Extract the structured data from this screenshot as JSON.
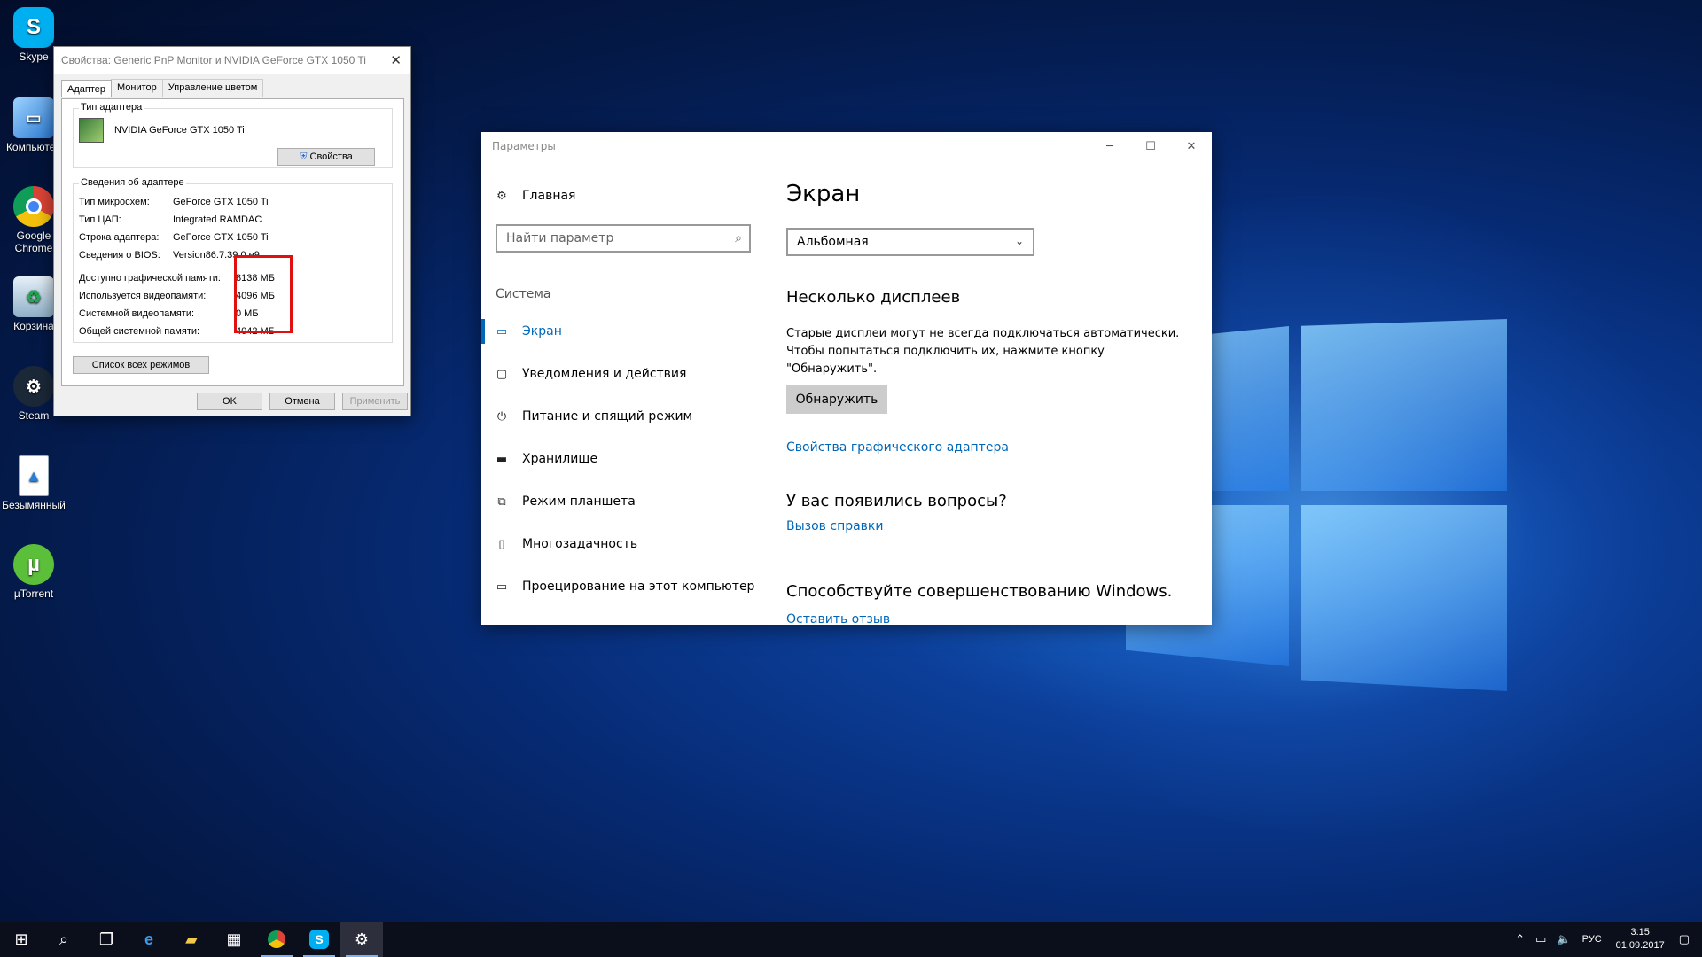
{
  "desktop": {
    "icons": [
      {
        "label": "Skype",
        "icon": "skype-icon",
        "color": "#00aff0"
      },
      {
        "label": "Компьютер",
        "icon": "computer-icon",
        "color": "#4a9be0"
      },
      {
        "label": "Google Chrome",
        "icon": "chrome-icon",
        "color": "#e0453a"
      },
      {
        "label": "Корзина",
        "icon": "recycle-bin-icon",
        "color": "#8fb0c8"
      },
      {
        "label": "Steam",
        "icon": "steam-icon",
        "color": "#1b2838"
      },
      {
        "label": "Безымянный",
        "icon": "image-file-icon",
        "color": "#e8f1fa"
      },
      {
        "label": "µTorrent",
        "icon": "utorrent-icon",
        "color": "#5bbf3a"
      }
    ]
  },
  "props": {
    "title": "Свойства: Generic PnP Monitor и NVIDIA GeForce GTX 1050 Ti",
    "tabs": [
      "Адаптер",
      "Монитор",
      "Управление цветом"
    ],
    "adapter_type_legend": "Тип адаптера",
    "adapter_name": "NVIDIA GeForce GTX 1050 Ti",
    "properties_button": "Свойства",
    "adapter_info_legend": "Сведения об адаптере",
    "info": [
      {
        "k": "Тип микросхем:",
        "v": "GeForce GTX 1050 Ti"
      },
      {
        "k": "Тип ЦАП:",
        "v": "Integrated RAMDAC"
      },
      {
        "k": "Строка адаптера:",
        "v": "GeForce GTX 1050 Ti"
      },
      {
        "k": "Сведения о BIOS:",
        "v": "Version86.7.39.0.e9"
      }
    ],
    "memory": [
      {
        "k": "Доступно графической памяти:",
        "v": "8138 МБ"
      },
      {
        "k": "Используется видеопамяти:",
        "v": "4096 МБ"
      },
      {
        "k": "Системной видеопамяти:",
        "v": "0 МБ"
      },
      {
        "k": "Общей системной памяти:",
        "v": "4042 МБ"
      }
    ],
    "list_modes_button": "Список всех режимов",
    "ok_button": "OK",
    "cancel_button": "Отмена",
    "apply_button": "Применить",
    "highlight_color": "#e01010"
  },
  "settings": {
    "title": "Параметры",
    "home": "Главная",
    "search_placeholder": "Найти параметр",
    "section": "Система",
    "nav": [
      {
        "label": "Экран",
        "icon": "monitor-icon",
        "active": true
      },
      {
        "label": "Уведомления и действия",
        "icon": "notifications-icon"
      },
      {
        "label": "Питание и спящий режим",
        "icon": "power-icon"
      },
      {
        "label": "Хранилище",
        "icon": "storage-icon"
      },
      {
        "label": "Режим планшета",
        "icon": "tablet-mode-icon"
      },
      {
        "label": "Многозадачность",
        "icon": "multitasking-icon"
      },
      {
        "label": "Проецирование на этот компьютер",
        "icon": "projecting-icon"
      }
    ],
    "page_title": "Экран",
    "orientation_value": "Альбомная",
    "multi_display_heading": "Несколько дисплеев",
    "multi_display_text": "Старые дисплеи могут не всегда подключаться автоматически. Чтобы попытаться подключить их, нажмите кнопку \"Обнаружить\".",
    "detect_button": "Обнаружить",
    "adapter_props_link": "Свойства графического адаптера",
    "questions_heading": "У вас появились вопросы?",
    "help_link": "Вызов справки",
    "improve_heading": "Способствуйте совершенствованию Windows.",
    "feedback_link": "Оставить отзыв",
    "accent_color": "#0067b8"
  },
  "taskbar": {
    "apps": [
      "start-icon",
      "search-icon",
      "task-view-icon",
      "edge-icon",
      "file-explorer-icon",
      "store-icon",
      "chrome-icon",
      "skype-icon",
      "settings-icon"
    ],
    "language": "РУС",
    "time": "3:15",
    "date": "01.09.2017"
  }
}
